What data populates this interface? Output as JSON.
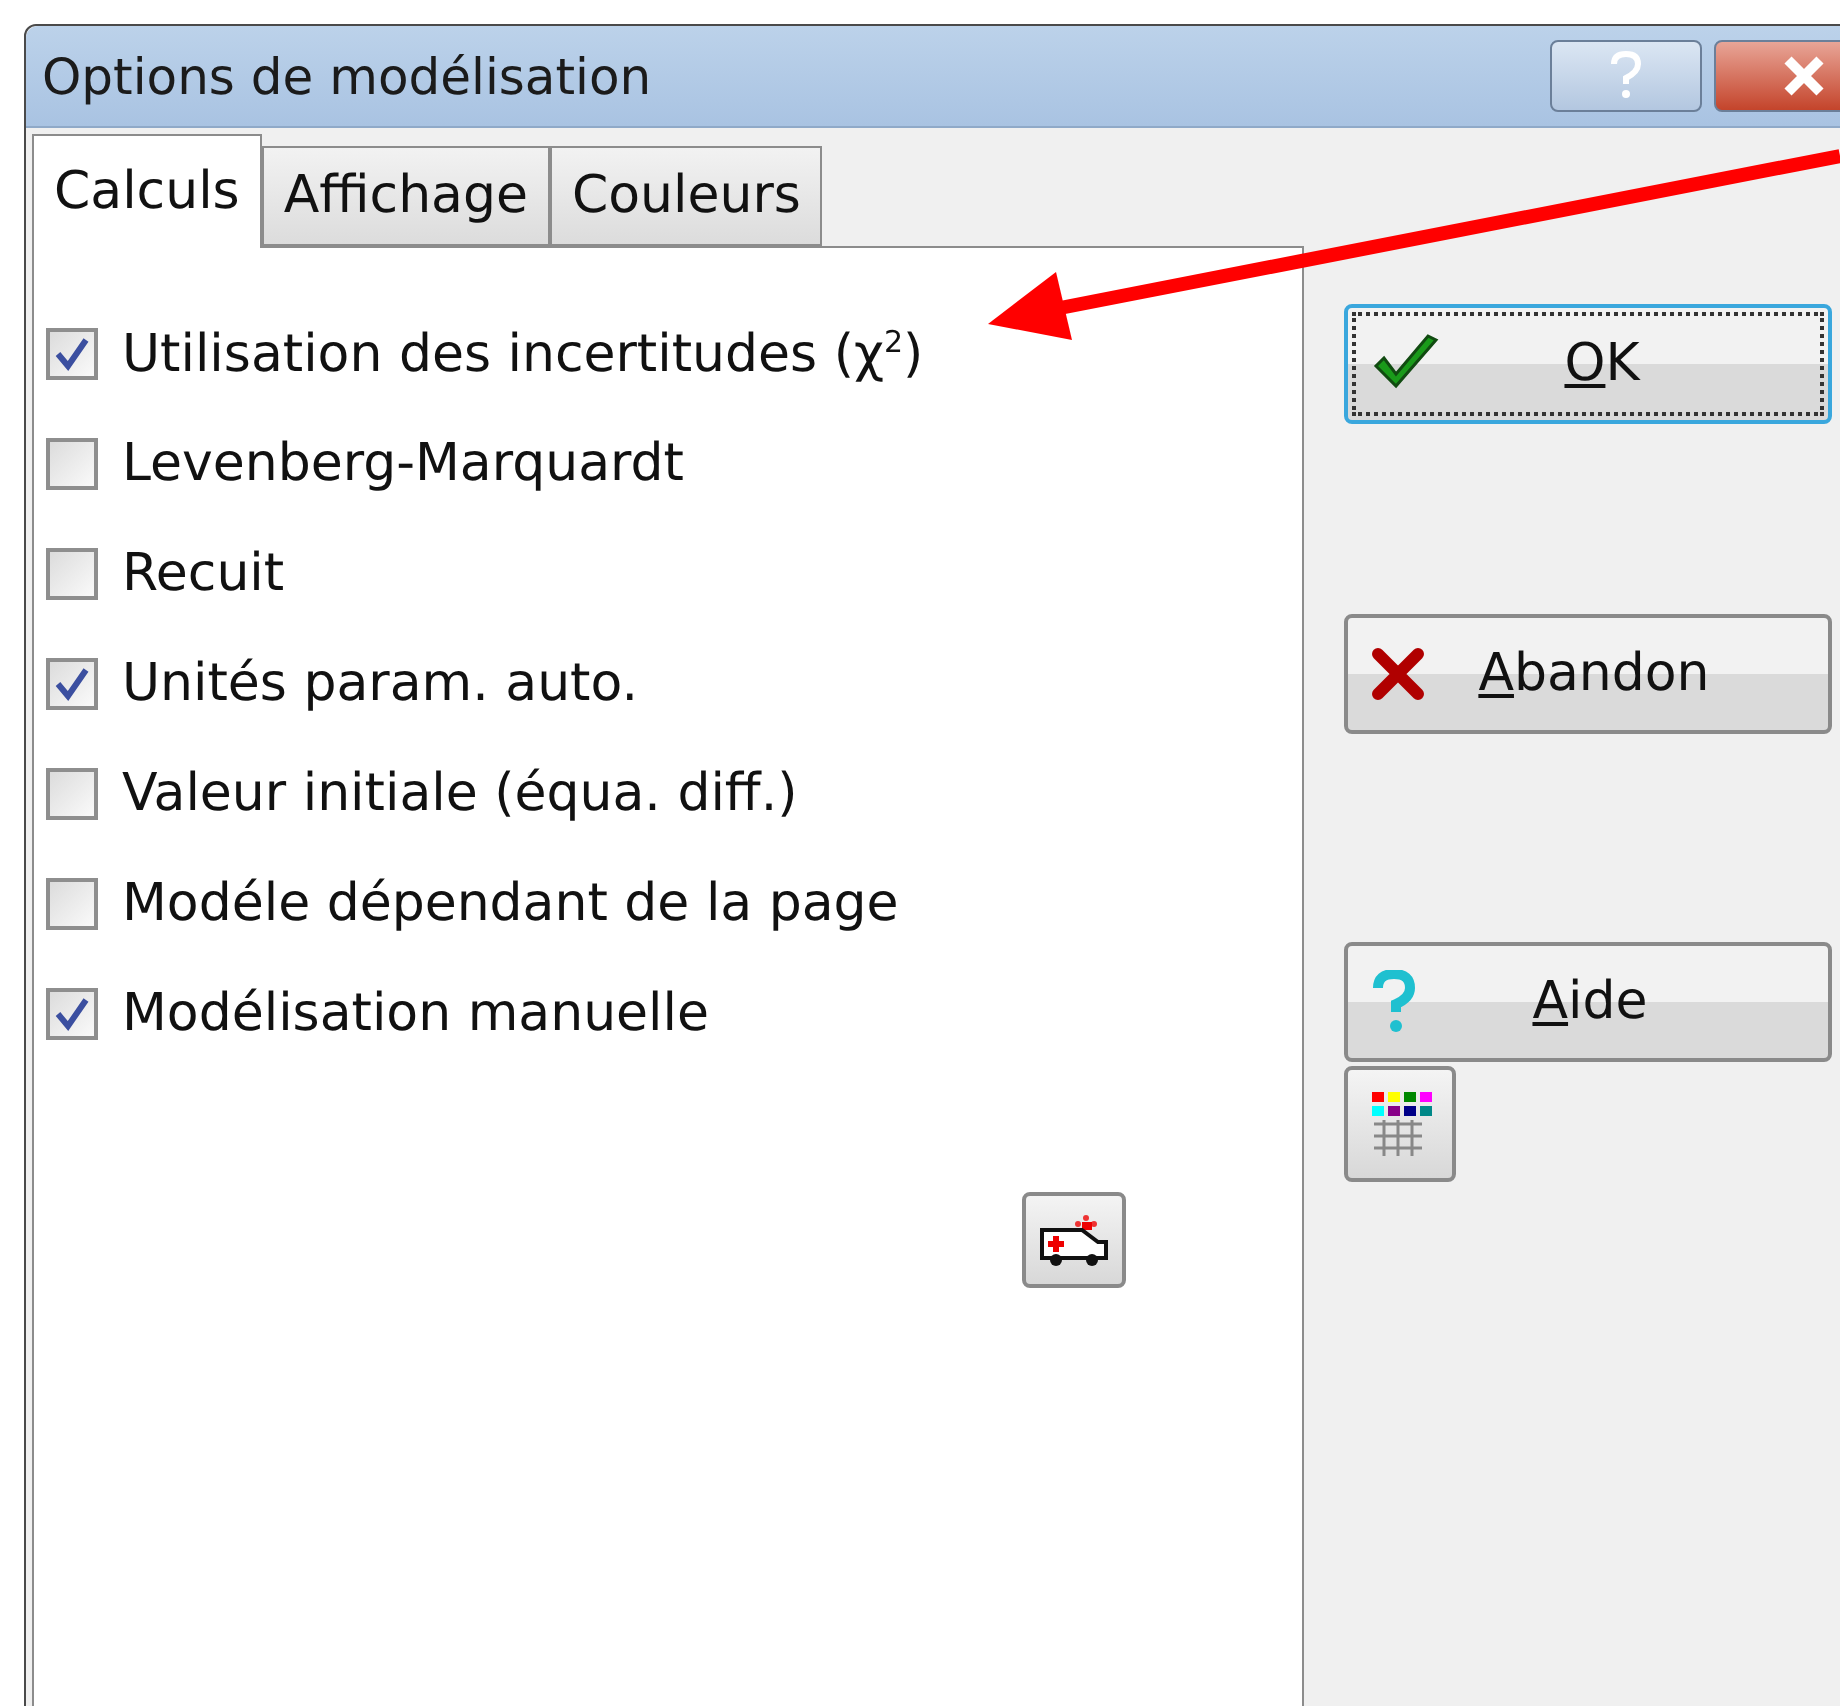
{
  "window": {
    "title": "Options de modélisation"
  },
  "tabs": [
    {
      "label": "Calculs",
      "selected": true
    },
    {
      "label": "Affichage",
      "selected": false
    },
    {
      "label": "Couleurs",
      "selected": false
    }
  ],
  "options": [
    {
      "label": "Utilisation des incertitudes (χ$^{2}$)",
      "checked": true
    },
    {
      "label": "Levenberg-Marquardt",
      "checked": false
    },
    {
      "label": "Recuit",
      "checked": false
    },
    {
      "label": "Unités param. auto.",
      "checked": true
    },
    {
      "label": "Valeur initiale (équa. diff.)",
      "checked": false
    },
    {
      "label": "Modéle dépendant de la page",
      "checked": false
    },
    {
      "label": "Modélisation manuelle",
      "checked": true
    }
  ],
  "buttons": [
    {
      "kind": "ok",
      "label": "OK",
      "focused": true
    },
    {
      "kind": "cancel",
      "label": "Abandon",
      "focused": false
    },
    {
      "kind": "help",
      "label": "Aide",
      "focused": false
    }
  ]
}
